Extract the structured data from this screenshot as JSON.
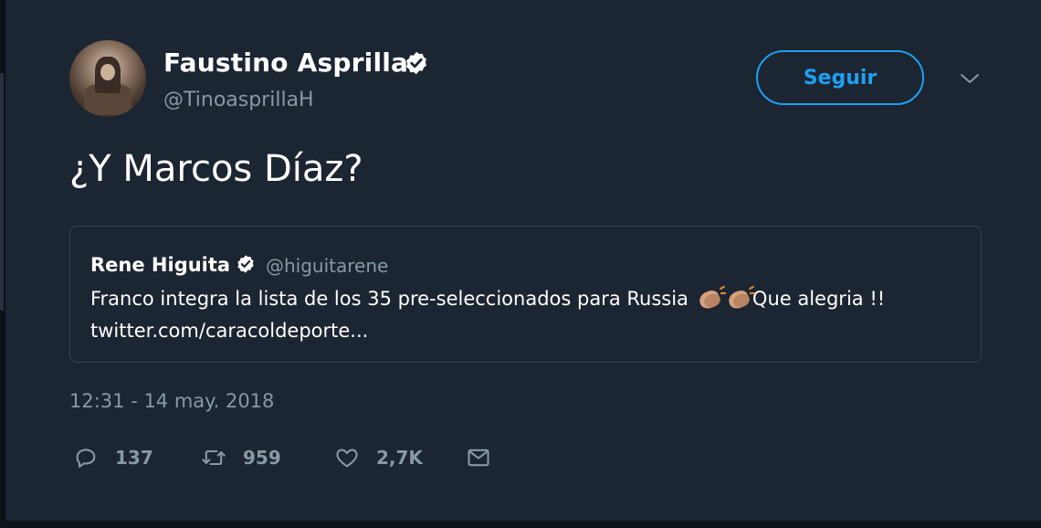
{
  "author": {
    "name": "Faustino Asprilla",
    "handle": "@TinoasprillaH"
  },
  "follow_button": {
    "label": "Seguir"
  },
  "tweet": {
    "text": "¿Y Marcos Díaz?",
    "timestamp": "12:31 - 14 may. 2018"
  },
  "quoted_tweet": {
    "name": "Rene Higuita",
    "handle": "@higuitarene",
    "text_before_emoji": "Franco integra la lista de los 35 pre-seleccionados para Russia",
    "text_after_emoji": "Que alegria !!",
    "link": "twitter.com/caracoldeporte..."
  },
  "actions": {
    "replies": "137",
    "retweets": "959",
    "likes": "2,7K"
  },
  "colors": {
    "background": "#1c2532",
    "accent": "#1da1f2",
    "secondary_text": "#8899a6",
    "border": "#38444d"
  },
  "icons": [
    "verified-badge-icon",
    "chevron-down-icon",
    "clapping-hands-emoji",
    "reply-icon",
    "retweet-icon",
    "like-icon",
    "direct-message-icon"
  ]
}
